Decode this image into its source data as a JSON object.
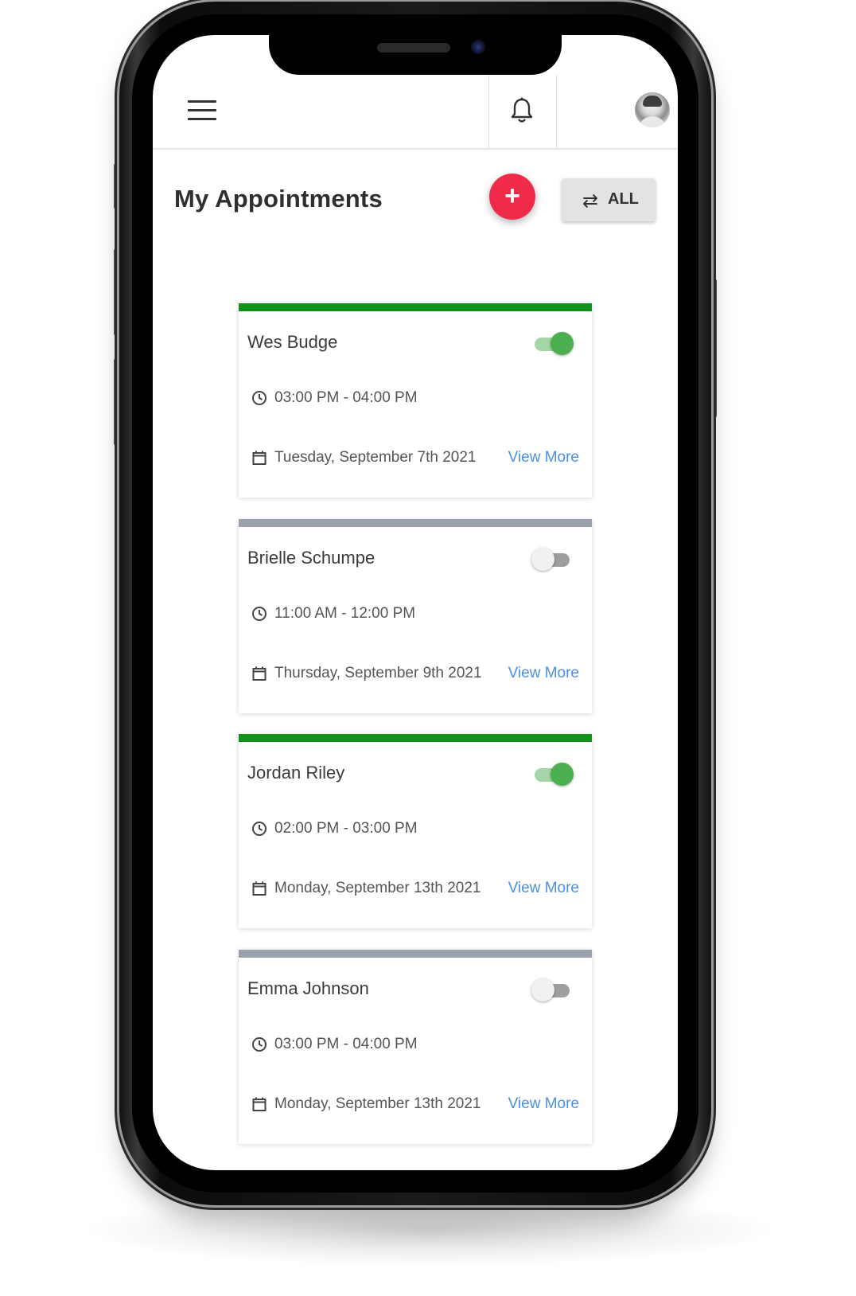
{
  "app": {
    "page_title": "My Appointments",
    "add_button_label": "+",
    "filter_button_label": "ALL",
    "filter_icon": "swap-arrows-icon",
    "menu_icon": "hamburger-menu-icon",
    "notification_icon": "bell-icon",
    "avatar": "user-avatar"
  },
  "colors": {
    "accent_red": "#ef2a4a",
    "active_green": "#12921a",
    "inactive_gray": "#9aa1ac",
    "link_blue": "#4a90e2"
  },
  "appointments": [
    {
      "name": "Wes Budge",
      "active": true,
      "time": "03:00 PM - 04:00 PM",
      "date": "Tuesday, September 7th 2021",
      "link_label": "View More"
    },
    {
      "name": "Brielle Schumpe",
      "active": false,
      "time": "11:00 AM - 12:00 PM",
      "date": "Thursday, September 9th 2021",
      "link_label": "View More"
    },
    {
      "name": "Jordan Riley",
      "active": true,
      "time": "02:00 PM - 03:00 PM",
      "date": "Monday, September 13th 2021",
      "link_label": "View More"
    },
    {
      "name": "Emma Johnson",
      "active": false,
      "time": "03:00 PM - 04:00 PM",
      "date": "Monday, September 13th 2021",
      "link_label": "View More"
    }
  ]
}
